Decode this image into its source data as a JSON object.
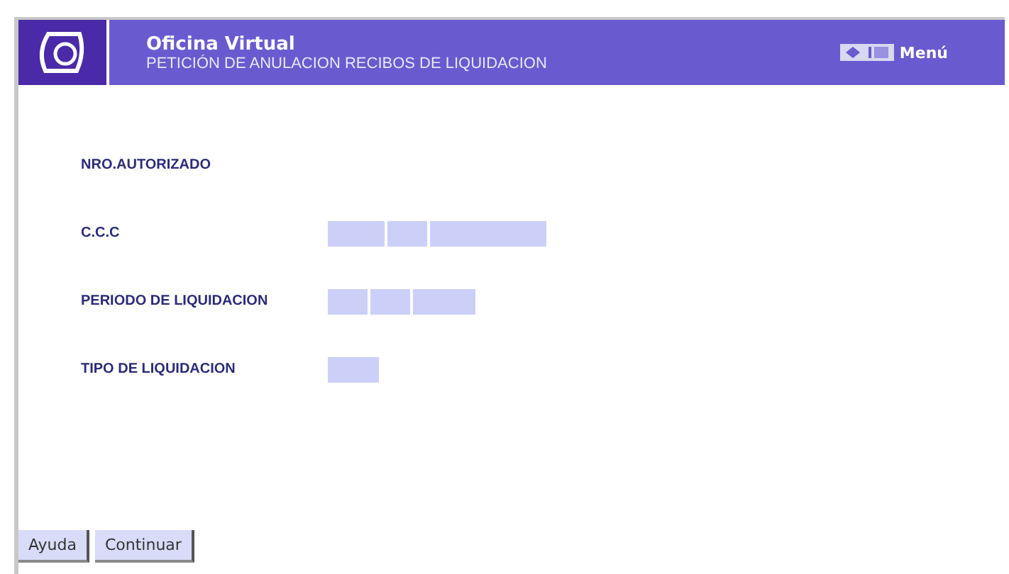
{
  "header": {
    "title": "Oficina Virtual",
    "subtitle": "PETICIÓN DE ANULACION RECIBOS DE LIQUIDACION",
    "menu": "Menú"
  },
  "fields": [
    {
      "label": "NRO.AUTORIZADO"
    },
    {
      "label": "C.C.C"
    },
    {
      "label": "PERIODO DE LIQUIDACION"
    },
    {
      "label": "TIPO DE LIQUIDACION"
    }
  ],
  "buttons": [
    "Ayuda",
    "Continuar"
  ]
}
